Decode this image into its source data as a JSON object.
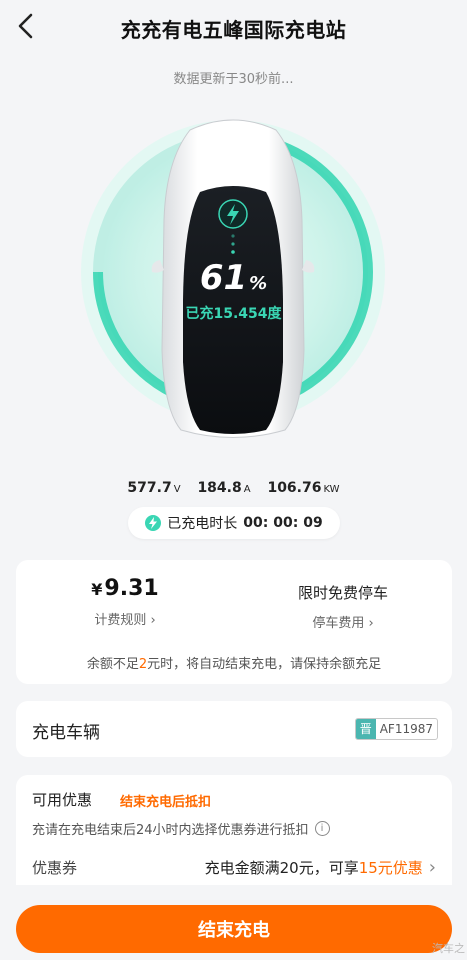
{
  "header": {
    "title": "充充有电五峰国际充电站",
    "back_icon": "chevron-left-icon"
  },
  "status": {
    "updated_text": "数据更新于30秒前..."
  },
  "charging": {
    "percent": "61",
    "percent_unit": "%",
    "charged_text": "已充15.454度",
    "ring_color": "#3ad6b4",
    "bolt_icon": "lightning-icon"
  },
  "metrics": {
    "voltage": "577.7",
    "voltage_unit": "V",
    "current": "184.8",
    "current_unit": "A",
    "power": "106.76",
    "power_unit": "KW"
  },
  "duration": {
    "label": "已充电时长",
    "value": "00:  00:  09"
  },
  "billing": {
    "currency": "¥",
    "amount": "9.31",
    "rules_link": "计费规则 ›",
    "parking_title": "限时免费停车",
    "parking_link": "停车费用 ›",
    "tip_prefix": "余额不足",
    "tip_amount": "2",
    "tip_suffix": "元时，将自动结束充电，请保持余额充足"
  },
  "vehicle": {
    "label": "充电车辆",
    "plate_province": "晋",
    "plate_number": "AF11987"
  },
  "promotion": {
    "title": "可用优惠",
    "tag": "结束充电后抵扣",
    "hint": "充请在充电结束后24小时内选择优惠券进行抵扣",
    "info_icon": "info-icon",
    "coupon_label": "优惠券",
    "coupon_prefix": "充电金额满20元，可享",
    "coupon_highlight": "15元优惠",
    "coupon_chevron": "›"
  },
  "actions": {
    "end_label": "结束充电"
  },
  "watermark": "汽车之"
}
